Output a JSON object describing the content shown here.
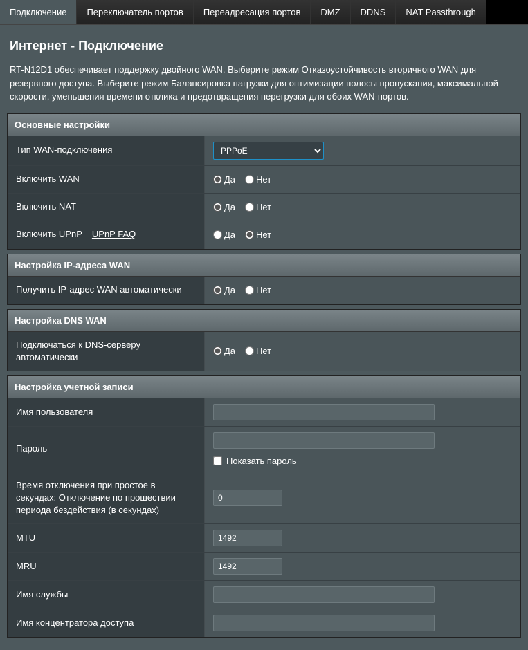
{
  "tabs": {
    "connection": "Подключение",
    "portSwitch": "Переключатель портов",
    "portForward": "Переадресация портов",
    "dmz": "DMZ",
    "ddns": "DDNS",
    "natPass": "NAT Passthrough"
  },
  "page": {
    "title": "Интернет - Подключение",
    "description": "RT-N12D1 обеспечивает поддержку двойного WAN. Выберите режим Отказоустойчивость вторичного WAN для резервного доступа. Выберите режим Балансировка нагрузки для оптимизации полосы пропускания, максимальной скорости, уменьшения времени отклика и предотвращения перегрузки для обоих WAN-портов."
  },
  "sections": {
    "basic": {
      "title": "Основные настройки",
      "wanTypeLabel": "Тип WAN-подключения",
      "wanTypeValue": "PPPoE",
      "enableWanLabel": "Включить WAN",
      "enableNatLabel": "Включить NAT",
      "enableUpnpLabel": "Включить UPnP",
      "upnpFaq": "UPnP  FAQ"
    },
    "wanIp": {
      "title": "Настройка IP-адреса WAN",
      "autoIpLabel": "Получить IP-адрес WAN автоматически"
    },
    "dns": {
      "title": "Настройка DNS WAN",
      "autoDnsLabel": "Подключаться к DNS-серверу автоматически"
    },
    "account": {
      "title": "Настройка учетной записи",
      "usernameLabel": "Имя пользователя",
      "passwordLabel": "Пароль",
      "showPasswordLabel": "Показать пароль",
      "idleLabel": "Время отключения при простое в секундах: Отключение по прошествии периода бездействия (в секундах)",
      "idleValue": "0",
      "mtuLabel": "MTU",
      "mtuValue": "1492",
      "mruLabel": "MRU",
      "mruValue": "1492",
      "serviceLabel": "Имя службы",
      "concentratorLabel": "Имя концентратора доступа"
    }
  },
  "options": {
    "yes": "Да",
    "no": "Нет"
  }
}
